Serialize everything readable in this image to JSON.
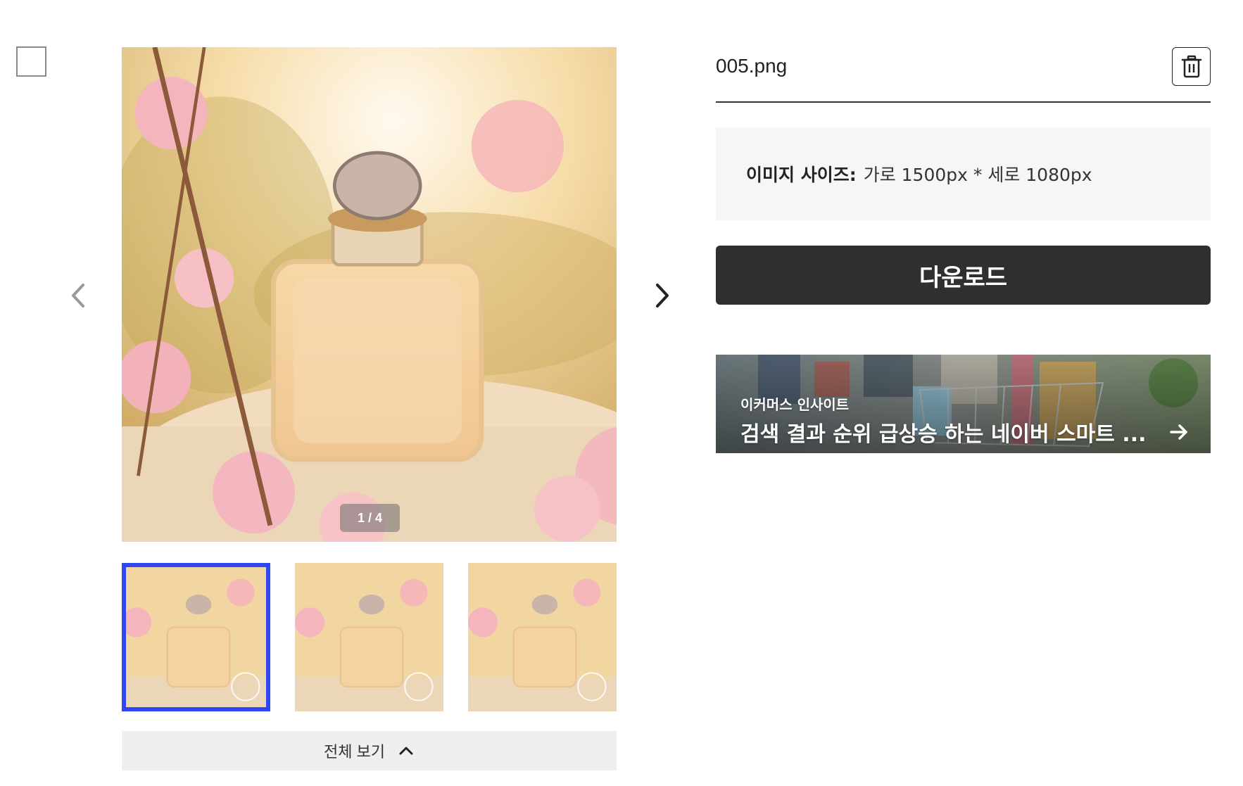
{
  "viewer": {
    "counter": "1 / 4",
    "prev_icon": "chevron-left-icon",
    "next_icon": "chevron-right-icon"
  },
  "thumbnails": {
    "count_visible": 3,
    "selected_index": 0
  },
  "view_all": {
    "label": "전체 보기",
    "icon": "chevron-up-icon"
  },
  "file": {
    "name": "005.png",
    "delete_icon": "trash-icon"
  },
  "image_size": {
    "label": "이미지 사이즈:",
    "value": "가로 1500px * 세로 1080px"
  },
  "download": {
    "label": "다운로드"
  },
  "banner": {
    "category": "이커머스 인사이트",
    "title": "검색 결과 순위 급상승 하는 네이버 스마트 ...",
    "icon": "arrow-right-icon"
  },
  "colors": {
    "selected_border": "#2f47f2",
    "download_bg": "#2f2f2f",
    "info_box_bg": "#f6f6f6",
    "view_all_bg": "#efefef"
  }
}
